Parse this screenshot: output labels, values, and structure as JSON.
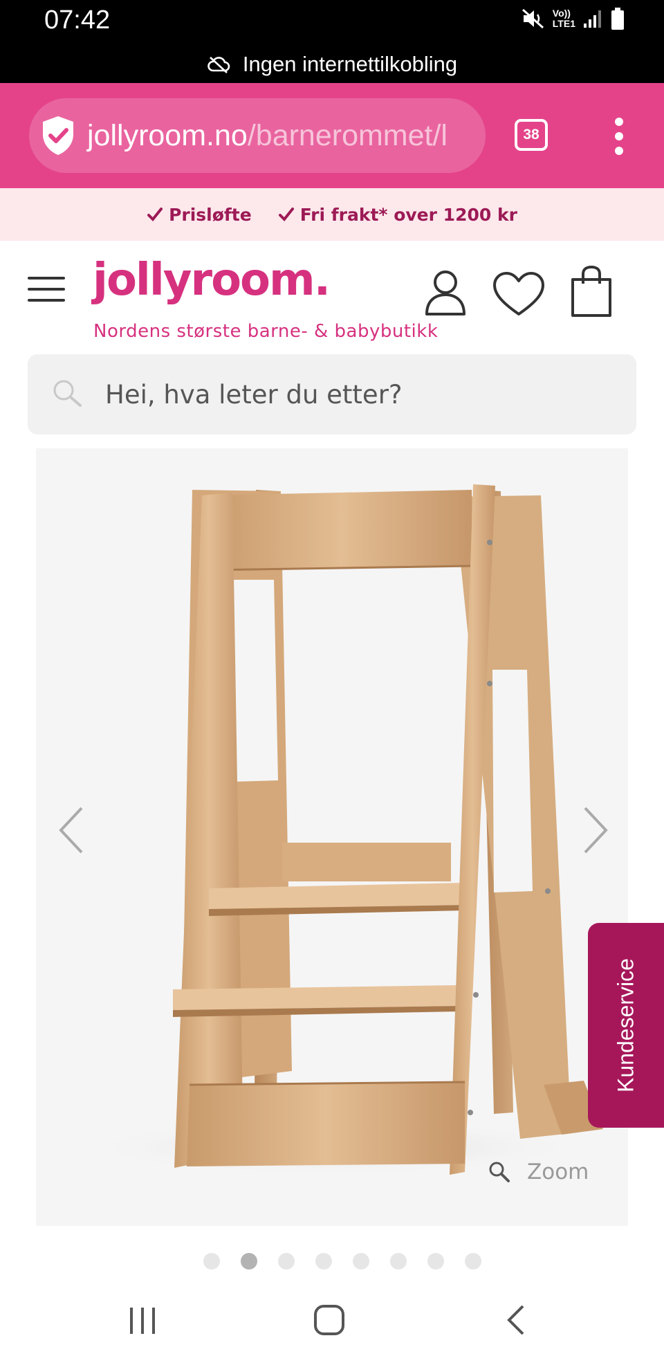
{
  "status_bar": {
    "time": "07:42",
    "network_label_top": "Vo))",
    "network_label_bottom": "LTE1"
  },
  "offline_banner": {
    "icon": "cloud-off-icon",
    "text": "Ingen internettilkobling"
  },
  "browser": {
    "url_domain": "jollyroom.no",
    "url_path": "/barnerommet/l",
    "tab_count": "38",
    "accent_color": "#e4438a"
  },
  "promo": {
    "items": [
      "Prisløfte",
      "Fri frakt* over 1200 kr"
    ]
  },
  "header": {
    "logo_text": "jollyroom.",
    "tagline": "Nordens største barne- & babybutikk",
    "brand_color": "#d6317f"
  },
  "search": {
    "placeholder": "Hei, hva leter du etter?"
  },
  "product": {
    "zoom_label": "Zoom",
    "image_count": 8,
    "active_image_index": 1
  },
  "kundeservice": {
    "label": "Kundeservice",
    "color": "#a6175a"
  }
}
